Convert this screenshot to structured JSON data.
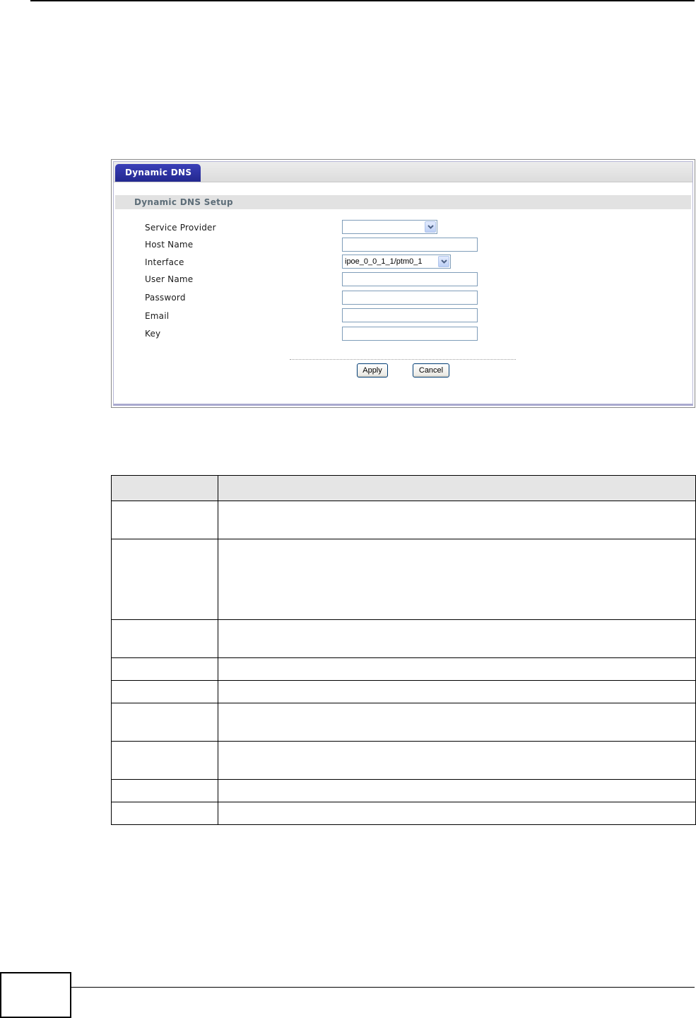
{
  "screenshot": {
    "tab_label": "Dynamic DNS",
    "section_title": "Dynamic DNS Setup",
    "fields": [
      {
        "label": "Service Provider",
        "type": "select",
        "value": ""
      },
      {
        "label": "Host Name",
        "type": "text",
        "value": ""
      },
      {
        "label": "Interface",
        "type": "select",
        "value": "ipoe_0_0_1_1/ptm0_1"
      },
      {
        "label": "User Name",
        "type": "text",
        "value": ""
      },
      {
        "label": "Password",
        "type": "text",
        "value": ""
      },
      {
        "label": "Email",
        "type": "text",
        "value": ""
      },
      {
        "label": "Key",
        "type": "text",
        "value": ""
      }
    ],
    "apply_label": "Apply",
    "cancel_label": "Cancel"
  },
  "table": {
    "headers": [
      "",
      ""
    ],
    "rows": [
      [
        "",
        ""
      ],
      [
        "",
        ""
      ],
      [
        "",
        ""
      ],
      [
        "",
        ""
      ],
      [
        "",
        ""
      ],
      [
        "",
        ""
      ],
      [
        "",
        ""
      ],
      [
        "",
        ""
      ],
      [
        "",
        ""
      ]
    ]
  },
  "colors": {
    "tab_blue": "#2d32a6",
    "section_bar": "#e2e2e2",
    "section_title": "#5d6d78",
    "input_border": "#7f9db9"
  },
  "icons": {
    "select_arrow": "chevron-down-icon"
  }
}
